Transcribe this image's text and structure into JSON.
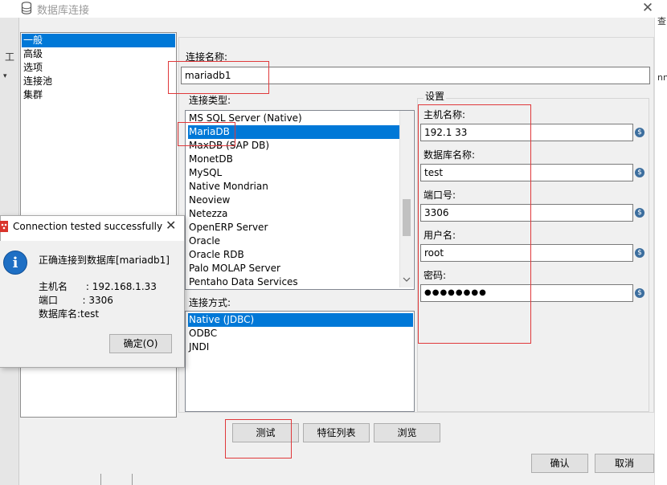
{
  "window": {
    "title": "数据库连接",
    "close_glyph": "✕"
  },
  "background": {
    "left_label": "工",
    "left_arrow": "▾",
    "right_label_1": "查",
    "right_label_2": "nn"
  },
  "nav": {
    "items": [
      {
        "label": "一般",
        "selected": true
      },
      {
        "label": "高级",
        "selected": false
      },
      {
        "label": "选项",
        "selected": false
      },
      {
        "label": "连接池",
        "selected": false
      },
      {
        "label": "集群",
        "selected": false
      }
    ]
  },
  "form": {
    "conn_name_label": "连接名称:",
    "conn_name_value": "mariadb1",
    "conn_type_label": "连接类型:",
    "conn_types": [
      {
        "label": "MS SQL Server (Native)",
        "selected": false
      },
      {
        "label": "MariaDB",
        "selected": true
      },
      {
        "label": "MaxDB (SAP DB)",
        "selected": false
      },
      {
        "label": "MonetDB",
        "selected": false
      },
      {
        "label": "MySQL",
        "selected": false
      },
      {
        "label": "Native Mondrian",
        "selected": false
      },
      {
        "label": "Neoview",
        "selected": false
      },
      {
        "label": "Netezza",
        "selected": false
      },
      {
        "label": "OpenERP Server",
        "selected": false
      },
      {
        "label": "Oracle",
        "selected": false
      },
      {
        "label": "Oracle RDB",
        "selected": false
      },
      {
        "label": "Palo MOLAP Server",
        "selected": false
      },
      {
        "label": "Pentaho Data Services",
        "selected": false
      }
    ],
    "access_label": "连接方式:",
    "access_types": [
      {
        "label": "Native (JDBC)",
        "selected": true
      },
      {
        "label": "ODBC",
        "selected": false
      },
      {
        "label": "JNDI",
        "selected": false
      }
    ],
    "settings_label": "设置",
    "host_label": "主机名称:",
    "host_value": "192.1        33",
    "db_label": "数据库名称:",
    "db_value": "test",
    "port_label": "端口号:",
    "port_value": "3306",
    "user_label": "用户名:",
    "user_value": "root",
    "password_label": "密码:",
    "password_value": "●●●●●●●●",
    "var_icon_glyph": "$"
  },
  "buttons": {
    "test": "测试",
    "features": "特征列表",
    "explore": "浏览",
    "ok": "确认",
    "cancel": "取消"
  },
  "dialog": {
    "title": "Connection tested successfully",
    "close_glyph": "✕",
    "info_glyph": "i",
    "message": "正确连接到数据库[mariadb1]",
    "host_line": "主机名      : 192.168.1.33",
    "port_line": "端口        : 3306",
    "db_line": "数据库名:test",
    "ok_button": "确定(O)"
  },
  "colors": {
    "selection": "#0078d7",
    "annotation": "#e0393b",
    "info_icon": "#1e6fc4"
  }
}
